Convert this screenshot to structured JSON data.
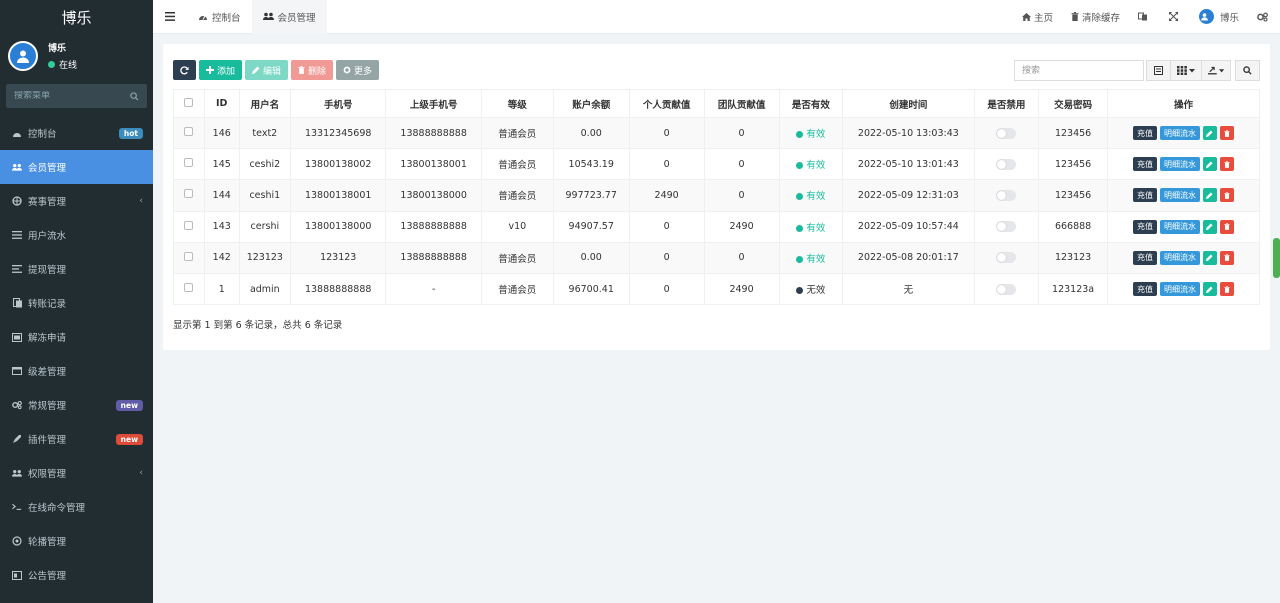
{
  "app": {
    "logo": "博乐"
  },
  "user": {
    "name": "博乐",
    "status": "在线"
  },
  "sidebar": {
    "search_placeholder": "搜索菜单",
    "items": [
      {
        "label": "控制台",
        "badge": "hot",
        "badge_color": "#3c8dbc"
      },
      {
        "label": "会员管理",
        "active": true
      },
      {
        "label": "赛事管理",
        "chevron": true
      },
      {
        "label": "用户流水"
      },
      {
        "label": "提现管理"
      },
      {
        "label": "转账记录"
      },
      {
        "label": "解冻申请"
      },
      {
        "label": "级差管理"
      },
      {
        "label": "常规管理",
        "badge": "new",
        "badge_color": "#605ca8"
      },
      {
        "label": "插件管理",
        "badge": "new",
        "badge_color": "#dd4b39"
      },
      {
        "label": "权限管理",
        "chevron": true
      },
      {
        "label": "在线命令管理"
      },
      {
        "label": "轮播管理"
      },
      {
        "label": "公告管理"
      }
    ]
  },
  "topbar": {
    "tabs": [
      {
        "label": "控制台"
      },
      {
        "label": "会员管理"
      }
    ],
    "home": "主页",
    "clear_cache": "清除缓存",
    "username": "博乐"
  },
  "toolbar": {
    "add": "添加",
    "edit": "编辑",
    "delete": "删除",
    "more": "更多",
    "search_placeholder": "搜索"
  },
  "table": {
    "headers": [
      "ID",
      "用户名",
      "手机号",
      "上级手机号",
      "等级",
      "账户余额",
      "个人贡献值",
      "团队贡献值",
      "是否有效",
      "创建时间",
      "是否禁用",
      "交易密码",
      "操作"
    ],
    "rows": [
      {
        "id": "146",
        "username": "text2",
        "phone": "13312345698",
        "parent_phone": "13888888888",
        "level": "普通会员",
        "balance": "0.00",
        "personal": "0",
        "team": "0",
        "valid": "有效",
        "valid_state": true,
        "created": "2022-05-10 13:03:43",
        "trade_pwd": "123456"
      },
      {
        "id": "145",
        "username": "ceshi2",
        "phone": "13800138002",
        "parent_phone": "13800138001",
        "level": "普通会员",
        "balance": "10543.19",
        "personal": "0",
        "team": "0",
        "valid": "有效",
        "valid_state": true,
        "created": "2022-05-10 13:01:43",
        "trade_pwd": "123456"
      },
      {
        "id": "144",
        "username": "ceshi1",
        "phone": "13800138001",
        "parent_phone": "13800138000",
        "level": "普通会员",
        "balance": "997723.77",
        "personal": "2490",
        "team": "0",
        "valid": "有效",
        "valid_state": true,
        "created": "2022-05-09 12:31:03",
        "trade_pwd": "123456"
      },
      {
        "id": "143",
        "username": "cershi",
        "phone": "13800138000",
        "parent_phone": "13888888888",
        "level": "v10",
        "balance": "94907.57",
        "personal": "0",
        "team": "2490",
        "valid": "有效",
        "valid_state": true,
        "created": "2022-05-09 10:57:44",
        "trade_pwd": "666888"
      },
      {
        "id": "142",
        "username": "123123",
        "phone": "123123",
        "parent_phone": "13888888888",
        "level": "普通会员",
        "balance": "0.00",
        "personal": "0",
        "team": "0",
        "valid": "有效",
        "valid_state": true,
        "created": "2022-05-08 20:01:17",
        "trade_pwd": "123123"
      },
      {
        "id": "1",
        "username": "admin",
        "phone": "13888888888",
        "parent_phone": "-",
        "level": "普通会员",
        "balance": "96700.41",
        "personal": "0",
        "team": "2490",
        "valid": "无效",
        "valid_state": false,
        "created": "无",
        "trade_pwd": "123123a"
      }
    ],
    "ops": {
      "recharge": "充值",
      "detail": "明细流水"
    }
  },
  "footer": {
    "summary": "显示第 1 到第 6 条记录，总共 6 条记录"
  },
  "colors": {
    "sidebar_bg": "#222d32",
    "active": "#4a90e2",
    "add": "#18bc9c",
    "edit": "#7dd9c6",
    "delete": "#f19a95",
    "more": "#95a5a6",
    "refresh": "#2c3e50",
    "valid": "#18bc9c",
    "invalid": "#2c3e50",
    "recharge": "#2c3e50",
    "detail": "#3498db"
  }
}
